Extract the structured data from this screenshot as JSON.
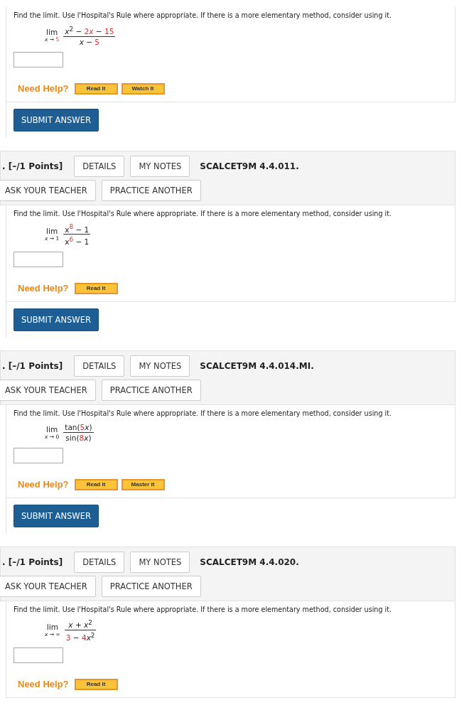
{
  "sections": [
    {
      "problem": {
        "instruction": "Find the limit. Use l'Hospital's Rule where appropriate. If there is a more elementary method, consider using it.",
        "limit": {
          "word": "lim",
          "approach": [
            {
              "text": "*x* → ",
              "highlighted": false
            },
            {
              "text": "5",
              "highlighted": true
            }
          ],
          "numerator": [
            {
              "text": "*x*$^{2}$ − ",
              "highlighted": false
            },
            {
              "text": "2",
              "highlighted": true
            },
            {
              "text": "*x*",
              "highlighted": true
            },
            {
              "text": " − ",
              "highlighted": false
            },
            {
              "text": "15",
              "highlighted": true
            }
          ],
          "denominator": [
            {
              "text": "*x* − ",
              "highlighted": false
            },
            {
              "text": "5",
              "highlighted": true
            }
          ]
        },
        "need_help": "Need Help?",
        "help_buttons": [
          "Read It",
          "Watch It"
        ]
      },
      "submit": "SUBMIT ANSWER"
    },
    {
      "header": {
        "points": ". [–/1 Points]",
        "buttons": [
          "DETAILS",
          "MY NOTES"
        ],
        "code": "SCALCET9M 4.4.011.",
        "actions": [
          "ASK YOUR TEACHER",
          "PRACTICE ANOTHER"
        ]
      },
      "problem": {
        "instruction": "Find the limit. Use l'Hospital's Rule where appropriate. If there is a more elementary method, consider using it.",
        "limit": {
          "word": "lim",
          "approach": [
            {
              "text": "*x* → 1",
              "highlighted": false
            }
          ],
          "numerator": [
            {
              "text": "x",
              "highlighted": false
            },
            {
              "text": "$^{8}$",
              "highlighted": true
            },
            {
              "text": " − 1",
              "highlighted": false
            }
          ],
          "denominator": [
            {
              "text": "x",
              "highlighted": false
            },
            {
              "text": "$^{6}$",
              "highlighted": true
            },
            {
              "text": " − 1",
              "highlighted": false
            }
          ]
        },
        "need_help": "Need Help?",
        "help_buttons": [
          "Read It"
        ]
      },
      "submit": "SUBMIT ANSWER"
    },
    {
      "header": {
        "points": ". [–/1 Points]",
        "buttons": [
          "DETAILS",
          "MY NOTES"
        ],
        "code": "SCALCET9M 4.4.014.MI.",
        "actions": [
          "ASK YOUR TEACHER",
          "PRACTICE ANOTHER"
        ]
      },
      "problem": {
        "instruction": "Find the limit. Use l'Hospital's Rule where appropriate. If there is a more elementary method, consider using it.",
        "limit": {
          "word": "lim",
          "approach": [
            {
              "text": "*x* → 0",
              "highlighted": false
            }
          ],
          "numerator": [
            {
              "text": "tan(",
              "highlighted": false
            },
            {
              "text": "5",
              "highlighted": true
            },
            {
              "text": "*x*)",
              "highlighted": false
            }
          ],
          "denominator": [
            {
              "text": "sin(",
              "highlighted": false
            },
            {
              "text": "8",
              "highlighted": true
            },
            {
              "text": "*x*)",
              "highlighted": false
            }
          ]
        },
        "need_help": "Need Help?",
        "help_buttons": [
          "Read It",
          "Master It"
        ]
      },
      "submit": "SUBMIT ANSWER"
    },
    {
      "header": {
        "points": ". [–/1 Points]",
        "buttons": [
          "DETAILS",
          "MY NOTES"
        ],
        "code": "SCALCET9M 4.4.020.",
        "actions": [
          "ASK YOUR TEACHER",
          "PRACTICE ANOTHER"
        ]
      },
      "problem": {
        "instruction": "Find the limit. Use l'Hospital's Rule where appropriate. If there is a more elementary method, consider using it.",
        "limit": {
          "word": "lim",
          "approach": [
            {
              "text": "*x* → ∞",
              "highlighted": false
            }
          ],
          "numerator": [
            {
              "text": "*x* + *x*$^{2}$",
              "highlighted": false
            }
          ],
          "denominator": [
            {
              "text": "3",
              "highlighted": true
            },
            {
              "text": " − ",
              "highlighted": false
            },
            {
              "text": "4",
              "highlighted": true
            },
            {
              "text": "*x*$^{2}$",
              "highlighted": false
            }
          ]
        },
        "need_help": "Need Help?",
        "help_buttons": [
          "Read It"
        ]
      }
    }
  ]
}
